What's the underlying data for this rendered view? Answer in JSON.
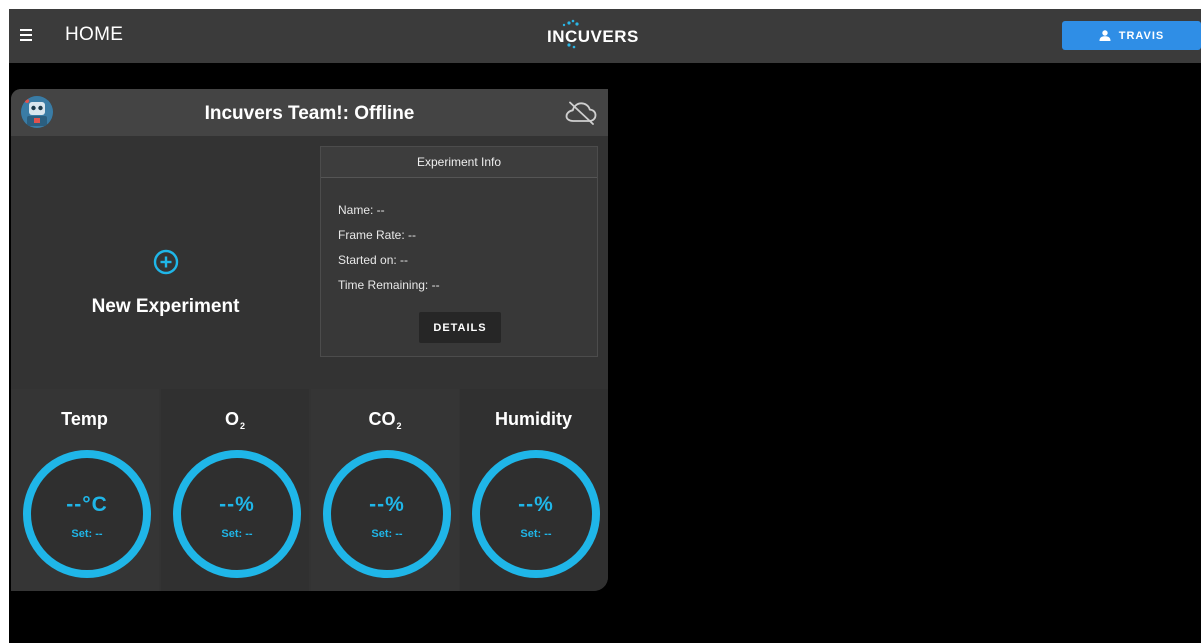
{
  "topbar": {
    "title": "HOME",
    "logo_text": "INCUVERS",
    "user_label": "TRAVIS"
  },
  "device": {
    "title": "Incuvers Team!: Offline",
    "status_icon": "cloud-offline-icon",
    "new_experiment_label": "New Experiment",
    "experiment_info": {
      "heading": "Experiment Info",
      "name": "Name: --",
      "frame_rate": "Frame Rate: --",
      "started_on": "Started on: --",
      "time_remaining": "Time Remaining: --",
      "details_label": "DETAILS"
    },
    "metrics": [
      {
        "label": "Temp",
        "sub": "",
        "value": "--°C",
        "set": "Set: --"
      },
      {
        "label": "O",
        "sub": "2",
        "value": "--%",
        "set": "Set: --"
      },
      {
        "label": "CO",
        "sub": "2",
        "value": "--%",
        "set": "Set: --"
      },
      {
        "label": "Humidity",
        "sub": "",
        "value": "--%",
        "set": "Set: --"
      }
    ]
  },
  "colors": {
    "accent": "#1fb6e8",
    "topbar": "#3b3b3b",
    "user_button": "#2f8ee6",
    "card": "#333333"
  }
}
